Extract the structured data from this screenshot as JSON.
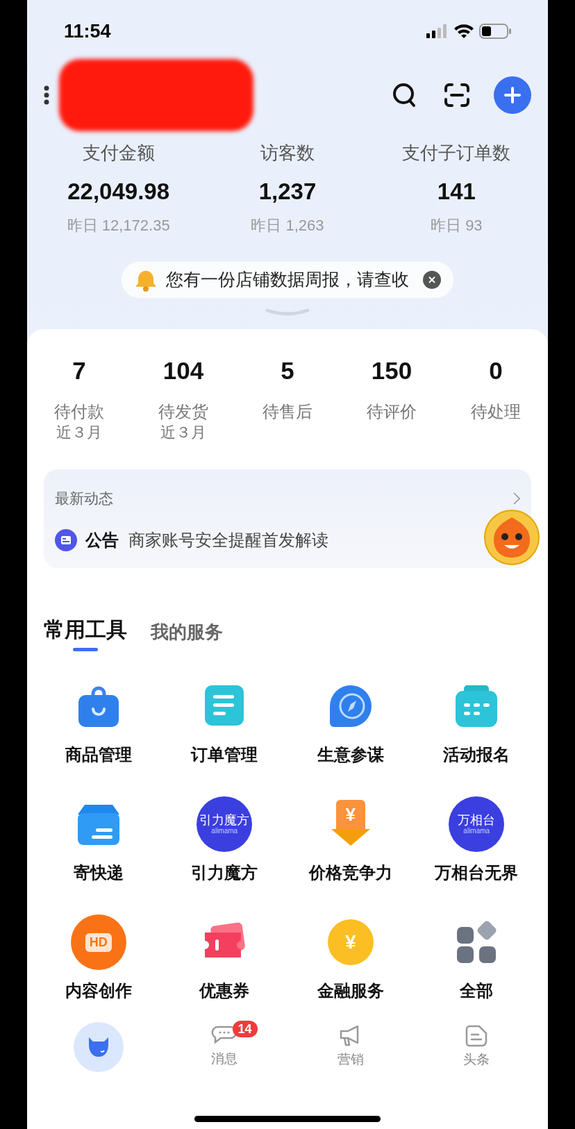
{
  "status_bar": {
    "time": "11:54"
  },
  "metrics": [
    {
      "label": "支付金额",
      "value": "22,049.98",
      "yesterday": "昨日 12,172.35"
    },
    {
      "label": "访客数",
      "value": "1,237",
      "yesterday": "昨日 1,263"
    },
    {
      "label": "支付子订单数",
      "value": "141",
      "yesterday": "昨日 93"
    }
  ],
  "notice": {
    "text": "您有一份店铺数据周报，请查收"
  },
  "orders": [
    {
      "count": "7",
      "label": "待付款",
      "note": "近３月"
    },
    {
      "count": "104",
      "label": "待发货",
      "note": "近３月"
    },
    {
      "count": "5",
      "label": "待售后"
    },
    {
      "count": "150",
      "label": "待评价"
    },
    {
      "count": "0",
      "label": "待处理"
    }
  ],
  "news": {
    "title": "最新动态",
    "tag": "公告",
    "text": "商家账号安全提醒首发解读"
  },
  "tabs": [
    {
      "label": "常用工具",
      "selected": true
    },
    {
      "label": "我的服务",
      "selected": false
    }
  ],
  "tools": [
    {
      "label": "商品管理"
    },
    {
      "label": "订单管理"
    },
    {
      "label": "生意参谋"
    },
    {
      "label": "活动报名"
    },
    {
      "label": "寄快递"
    },
    {
      "label": "引力魔方",
      "logo_text": "引力魔方",
      "logo_subtext": "alimama"
    },
    {
      "label": "价格竞争力",
      "logo_text": "¥"
    },
    {
      "label": "万相台无界",
      "logo_text": "万相台",
      "logo_subtext": "alimama"
    },
    {
      "label": "内容创作",
      "logo_text": "HD"
    },
    {
      "label": "优惠券"
    },
    {
      "label": "金融服务",
      "logo_text": "¥"
    },
    {
      "label": "全部"
    }
  ],
  "bottom_nav": [
    {
      "selected": true
    },
    {
      "label": "消息",
      "badge": "14",
      "selected": false
    },
    {
      "label": "营销",
      "selected": false
    },
    {
      "label": "头条",
      "selected": false
    }
  ]
}
